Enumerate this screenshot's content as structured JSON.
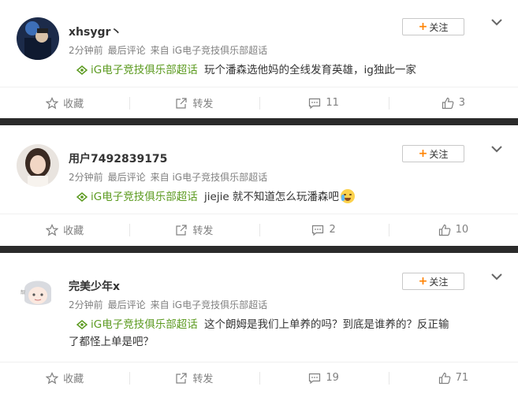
{
  "posts": [
    {
      "username": "xhsygr丶",
      "time": "2分钟前",
      "last_comment": "最后评论",
      "source": "来自 iG电子竞技俱乐部超话",
      "follow_label": "关注",
      "topic": "iG电子竞技俱乐部超话",
      "text": "玩个潘森选他妈的全线发育英雄，ig独此一家",
      "text_line2": "",
      "has_emoji": false,
      "actions": {
        "favorite": "收藏",
        "share": "转发",
        "comments": "11",
        "likes": "3"
      }
    },
    {
      "username": "用户7492839175",
      "time": "2分钟前",
      "last_comment": "最后评论",
      "source": "来自 iG电子竞技俱乐部超话",
      "follow_label": "关注",
      "topic": "iG电子竞技俱乐部超话",
      "text": "jiejie 就不知道怎么玩潘森吧",
      "text_line2": "",
      "has_emoji": true,
      "actions": {
        "favorite": "收藏",
        "share": "转发",
        "comments": "2",
        "likes": "10"
      }
    },
    {
      "username": "完美少年x",
      "time": "2分钟前",
      "last_comment": "最后评论",
      "source": "来自 iG电子竞技俱乐部超话",
      "follow_label": "关注",
      "topic": "iG电子竞技俱乐部超话",
      "text": "这个朗姆是我们上单养的吗？到底是谁养的？反正输",
      "text_line2": "了都怪上单是吧？",
      "has_emoji": false,
      "actions": {
        "favorite": "收藏",
        "share": "转发",
        "comments": "19",
        "likes": "71"
      }
    }
  ],
  "icons": {
    "topic": "topic-diamond-icon",
    "favorite": "star-icon",
    "share": "share-icon",
    "comment": "comment-icon",
    "like": "thumbs-up-icon",
    "more": "chevron-down-icon"
  },
  "colors": {
    "topic_green": "#5b9a1f",
    "follow_plus": "#ff8200",
    "meta_gray": "#808080",
    "divider_band": "#2b2b2b"
  }
}
